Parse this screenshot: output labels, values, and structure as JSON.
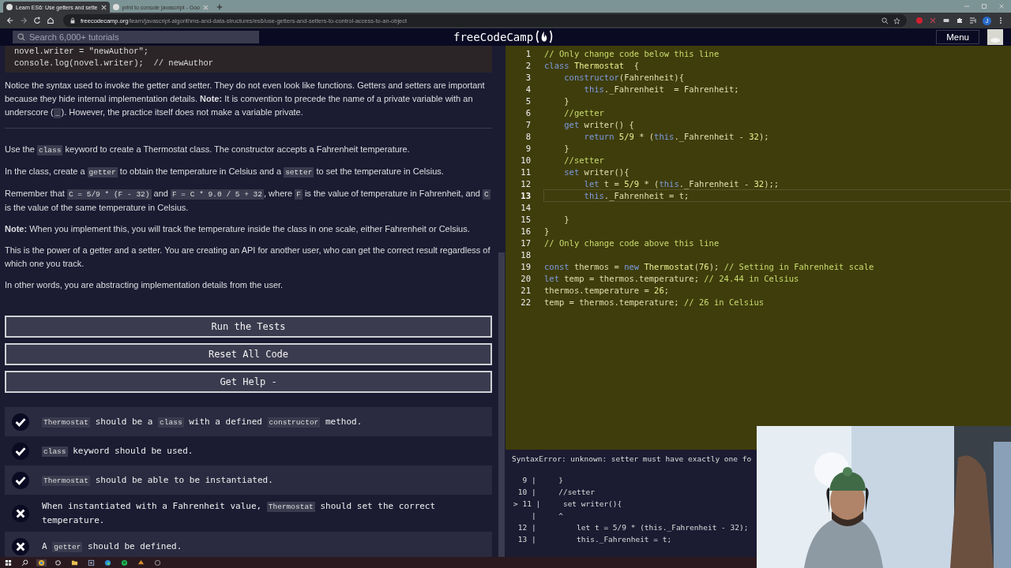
{
  "browser": {
    "tabs": [
      {
        "title": "Learn ES6: Use getters and sette",
        "selected": true
      },
      {
        "title": "print to console javascript - Goo",
        "selected": false
      }
    ],
    "url": {
      "host": "freecodecamp.org",
      "path": "/learn/javascript-algorithms-and-data-structures/es6/use-getters-and-setters-to-control-access-to-an-object"
    },
    "profile": "J"
  },
  "header": {
    "search": {
      "placeholder": "Search 6,000+ tutorials"
    },
    "logo": "freeCodeCamp",
    "menu": "Menu"
  },
  "lesson": {
    "snippet": [
      "novel.writer = \"newAuthor\";",
      "console.log(novel.writer);  // newAuthor"
    ],
    "paragraphs": [
      {
        "parts": [
          {
            "text": "Notice the syntax used to invoke the getter and setter. They do not even look like functions. Getters and setters are important because they hide internal implementation details. **Note:** It is convention to precede the name of a private variable with an underscore (",
            "kind": "text"
          },
          {
            "text": "_",
            "kind": "code"
          },
          {
            "text": "). However, the practice itself does not make a variable private.",
            "kind": "text"
          }
        ]
      },
      {
        "parts": [
          {
            "text": "Use the ",
            "kind": "text"
          },
          {
            "text": "class",
            "kind": "code"
          },
          {
            "text": " keyword to create a Thermostat class. The constructor accepts a Fahrenheit temperature.",
            "kind": "text"
          }
        ]
      },
      {
        "parts": [
          {
            "text": "In the class, create a ",
            "kind": "text"
          },
          {
            "text": "getter",
            "kind": "code"
          },
          {
            "text": " to obtain the temperature in Celsius and a ",
            "kind": "text"
          },
          {
            "text": "setter",
            "kind": "code"
          },
          {
            "text": " to set the temperature in Celsius.",
            "kind": "text"
          }
        ]
      },
      {
        "parts": [
          {
            "text": "Remember that ",
            "kind": "text"
          },
          {
            "text": "C = 5/9 * (F - 32)",
            "kind": "code"
          },
          {
            "text": " and ",
            "kind": "text"
          },
          {
            "text": "F = C * 9.0 / 5 + 32",
            "kind": "code"
          },
          {
            "text": ", where ",
            "kind": "text"
          },
          {
            "text": "F",
            "kind": "code"
          },
          {
            "text": " is the value of temperature in Fahrenheit, and ",
            "kind": "text"
          },
          {
            "text": "C",
            "kind": "code"
          },
          {
            "text": " is the value of the same temperature in Celsius.",
            "kind": "text"
          }
        ]
      },
      {
        "parts": [
          {
            "text": "**Note:** When you implement this, you will track the temperature inside the class in one scale, either Fahrenheit or Celsius.",
            "kind": "text"
          }
        ]
      },
      {
        "parts": [
          {
            "text": "This is the power of a getter and a setter. You are creating an API for another user, who can get the correct result regardless of which one you track.",
            "kind": "text"
          }
        ]
      },
      {
        "parts": [
          {
            "text": "In other words, you are abstracting implementation details from the user.",
            "kind": "text"
          }
        ]
      }
    ],
    "buttons": [
      "Run the Tests",
      "Reset All Code",
      "Get Help -"
    ],
    "tests": [
      {
        "passed": true,
        "parts": [
          {
            "text": "Thermostat",
            "kind": "code"
          },
          {
            "text": " should be a ",
            "kind": "text"
          },
          {
            "text": "class",
            "kind": "code"
          },
          {
            "text": " with a defined ",
            "kind": "text"
          },
          {
            "text": "constructor",
            "kind": "code"
          },
          {
            "text": " method.",
            "kind": "text"
          }
        ]
      },
      {
        "passed": true,
        "parts": [
          {
            "text": "class",
            "kind": "code"
          },
          {
            "text": " keyword should be used.",
            "kind": "text"
          }
        ]
      },
      {
        "passed": true,
        "parts": [
          {
            "text": "Thermostat",
            "kind": "code"
          },
          {
            "text": " should be able to be instantiated.",
            "kind": "text"
          }
        ]
      },
      {
        "passed": false,
        "parts": [
          {
            "text": "When instantiated with a Fahrenheit value, ",
            "kind": "text"
          },
          {
            "text": "Thermostat",
            "kind": "code"
          },
          {
            "text": " should set the correct temperature.",
            "kind": "text"
          }
        ]
      },
      {
        "passed": false,
        "parts": [
          {
            "text": "A ",
            "kind": "text"
          },
          {
            "text": "getter",
            "kind": "code"
          },
          {
            "text": " should be defined.",
            "kind": "text"
          }
        ]
      }
    ]
  },
  "editor": {
    "lines": [
      {
        "num": "1",
        "current": false,
        "tokens": [
          {
            "kind": "comment",
            "text": "// Only change code below this line"
          }
        ]
      },
      {
        "num": "2",
        "current": false,
        "tokens": [
          {
            "kind": "keyword",
            "text": "class "
          },
          {
            "kind": "name",
            "text": "Thermostat"
          },
          {
            "kind": "plain",
            "text": "  {"
          }
        ]
      },
      {
        "num": "3",
        "current": false,
        "tokens": [
          {
            "kind": "keyword",
            "text": "    constructor"
          },
          {
            "kind": "plain",
            "text": "(Fahrenheit){"
          }
        ]
      },
      {
        "num": "4",
        "current": false,
        "tokens": [
          {
            "kind": "keyword",
            "text": "        this"
          },
          {
            "kind": "plain",
            "text": "._Fahrenheit  = Fahrenheit;"
          }
        ]
      },
      {
        "num": "5",
        "current": false,
        "tokens": [
          {
            "kind": "plain",
            "text": "    }"
          }
        ]
      },
      {
        "num": "6",
        "current": false,
        "tokens": [
          {
            "kind": "comment",
            "text": "    //getter"
          }
        ]
      },
      {
        "num": "7",
        "current": false,
        "tokens": [
          {
            "kind": "keyword",
            "text": "    get"
          },
          {
            "kind": "plain",
            "text": " writer() {"
          }
        ]
      },
      {
        "num": "8",
        "current": false,
        "tokens": [
          {
            "kind": "keyword",
            "text": "        return"
          },
          {
            "kind": "name",
            "text": " 5/9"
          },
          {
            "kind": "plain",
            "text": " * ("
          },
          {
            "kind": "keyword",
            "text": "this"
          },
          {
            "kind": "plain",
            "text": "._Fahrenheit - "
          },
          {
            "kind": "name",
            "text": "32"
          },
          {
            "kind": "plain",
            "text": ");"
          }
        ]
      },
      {
        "num": "9",
        "current": false,
        "tokens": [
          {
            "kind": "plain",
            "text": "    }"
          }
        ]
      },
      {
        "num": "10",
        "current": false,
        "tokens": [
          {
            "kind": "comment",
            "text": "    //setter"
          }
        ]
      },
      {
        "num": "11",
        "current": false,
        "tokens": [
          {
            "kind": "keyword",
            "text": "    set"
          },
          {
            "kind": "plain",
            "text": " writer(){"
          }
        ]
      },
      {
        "num": "12",
        "current": false,
        "tokens": [
          {
            "kind": "keyword",
            "text": "        let"
          },
          {
            "kind": "plain",
            "text": " t = "
          },
          {
            "kind": "name",
            "text": "5/9"
          },
          {
            "kind": "plain",
            "text": " * ("
          },
          {
            "kind": "keyword",
            "text": "this"
          },
          {
            "kind": "plain",
            "text": "._Fahrenheit - "
          },
          {
            "kind": "name",
            "text": "32"
          },
          {
            "kind": "plain",
            "text": ");;"
          }
        ]
      },
      {
        "num": "13",
        "current": true,
        "tokens": [
          {
            "kind": "keyword",
            "text": "        this"
          },
          {
            "kind": "plain",
            "text": "._Fahrenheit = t;"
          }
        ]
      },
      {
        "num": "14",
        "current": false
      },
      {
        "num": "15",
        "current": false,
        "tokens": [
          {
            "kind": "plain",
            "text": "    }"
          }
        ]
      },
      {
        "num": "16",
        "current": false,
        "tokens": [
          {
            "kind": "plain",
            "text": "}"
          }
        ]
      },
      {
        "num": "17",
        "current": false,
        "tokens": [
          {
            "kind": "comment",
            "text": "// Only change code above this line"
          }
        ]
      },
      {
        "num": "18",
        "current": false
      },
      {
        "num": "19",
        "current": false,
        "tokens": [
          {
            "kind": "keyword",
            "text": "const"
          },
          {
            "kind": "plain",
            "text": " thermos = "
          },
          {
            "kind": "keyword",
            "text": "new "
          },
          {
            "kind": "name",
            "text": "Thermostat"
          },
          {
            "kind": "plain",
            "text": "("
          },
          {
            "kind": "name",
            "text": "76"
          },
          {
            "kind": "plain",
            "text": "); "
          },
          {
            "kind": "comment",
            "text": "// Setting in Fahrenheit scale"
          }
        ]
      },
      {
        "num": "20",
        "current": false,
        "tokens": [
          {
            "kind": "keyword",
            "text": "let"
          },
          {
            "kind": "plain",
            "text": " temp = thermos.temperature; "
          },
          {
            "kind": "comment",
            "text": "// 24.44 in Celsius"
          }
        ]
      },
      {
        "num": "21",
        "current": false,
        "tokens": [
          {
            "kind": "plain",
            "text": "thermos.temperature = "
          },
          {
            "kind": "name",
            "text": "26"
          },
          {
            "kind": "plain",
            "text": ";"
          }
        ]
      },
      {
        "num": "22",
        "current": false,
        "tokens": [
          {
            "kind": "plain",
            "text": "temp = thermos.temperature; "
          },
          {
            "kind": "comment",
            "text": "// 26 in Celsius"
          }
        ]
      }
    ]
  },
  "console": {
    "message": "SyntaxError: unknown: setter must have exactly one fo",
    "lines": [
      "  9 |     }",
      " 10 |     //setter",
      "> 11 |     set writer(){",
      "    |     ^",
      " 12 |         let t = 5/9 * (this._Fahrenheit - 32);",
      " 13 |         this._Fahrenheit = t;"
    ]
  }
}
